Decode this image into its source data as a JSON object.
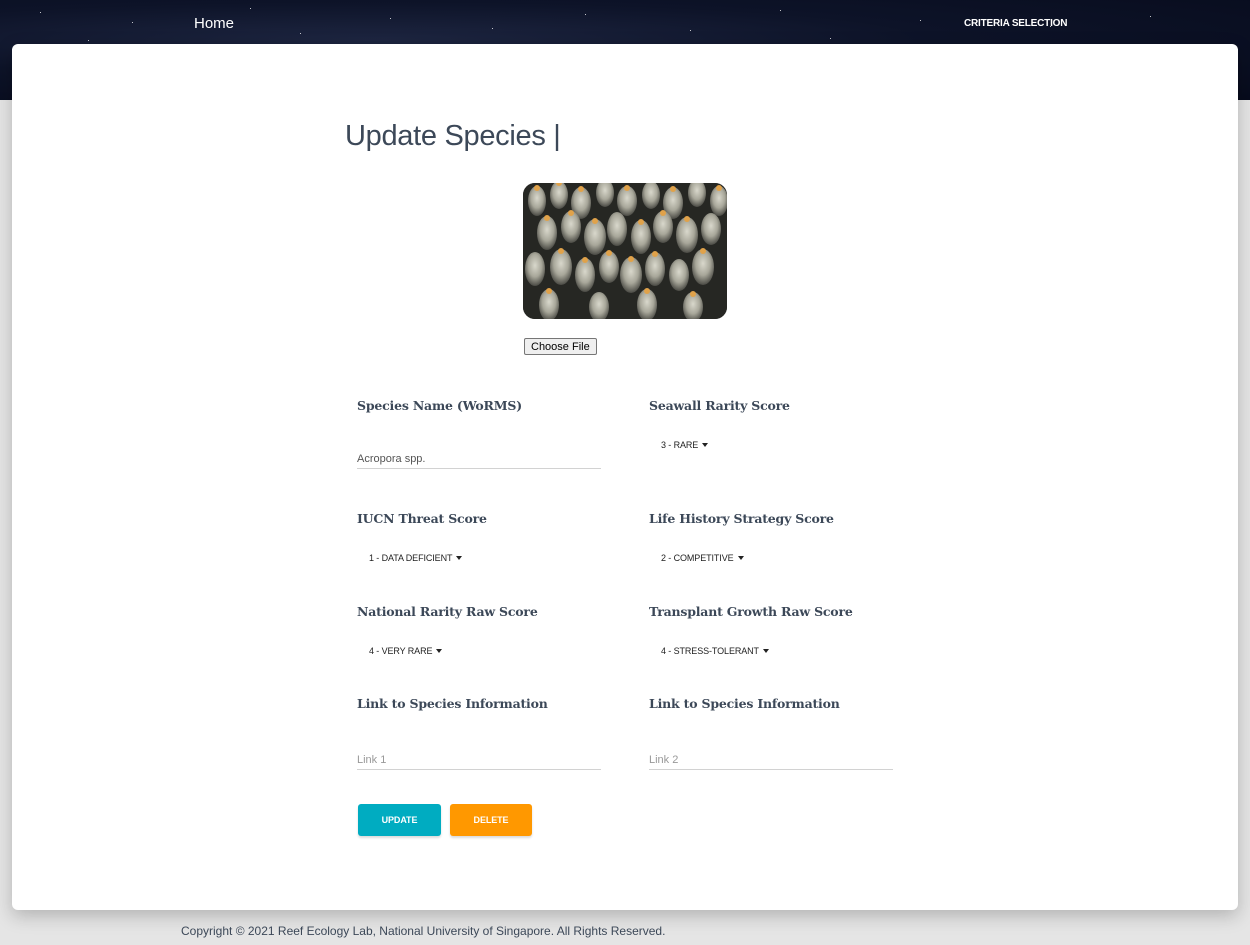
{
  "nav": {
    "home_label": "Home",
    "criteria_label": "CRITERIA SELECTION"
  },
  "page": {
    "title": "Update Species |"
  },
  "photo": {
    "alt": "coral photo",
    "choose_file_label": "Choose File"
  },
  "form": {
    "species_name": {
      "label": "Species Name (WoRMS)",
      "value": "Acropora spp."
    },
    "seawall_rarity": {
      "label": "Seawall Rarity Score",
      "selected": "3 - RARE"
    },
    "iucn_threat": {
      "label": "IUCN Threat Score",
      "selected": "1 - DATA DEFICIENT"
    },
    "life_history": {
      "label": "Life History Strategy Score",
      "selected": "2 - COMPETITIVE"
    },
    "national_rarity": {
      "label": "National Rarity Raw Score",
      "selected": "4 - VERY RARE"
    },
    "transplant_growth": {
      "label": "Transplant Growth Raw Score",
      "selected": "4 - STRESS-TOLERANT"
    },
    "link1": {
      "label": "Link to Species Information",
      "placeholder": "Link 1"
    },
    "link2": {
      "label": "Link to Species Information",
      "placeholder": "Link 2"
    }
  },
  "buttons": {
    "update_label": "UPDATE",
    "delete_label": "DELETE"
  },
  "footer": {
    "text": "Copyright © 2021 Reef Ecology Lab, National University of Singapore. All Rights Reserved."
  },
  "colors": {
    "header_bg": "#0d1328",
    "update_button": "#00acc1",
    "delete_button": "#ff9800",
    "text_primary": "#3c4858"
  }
}
